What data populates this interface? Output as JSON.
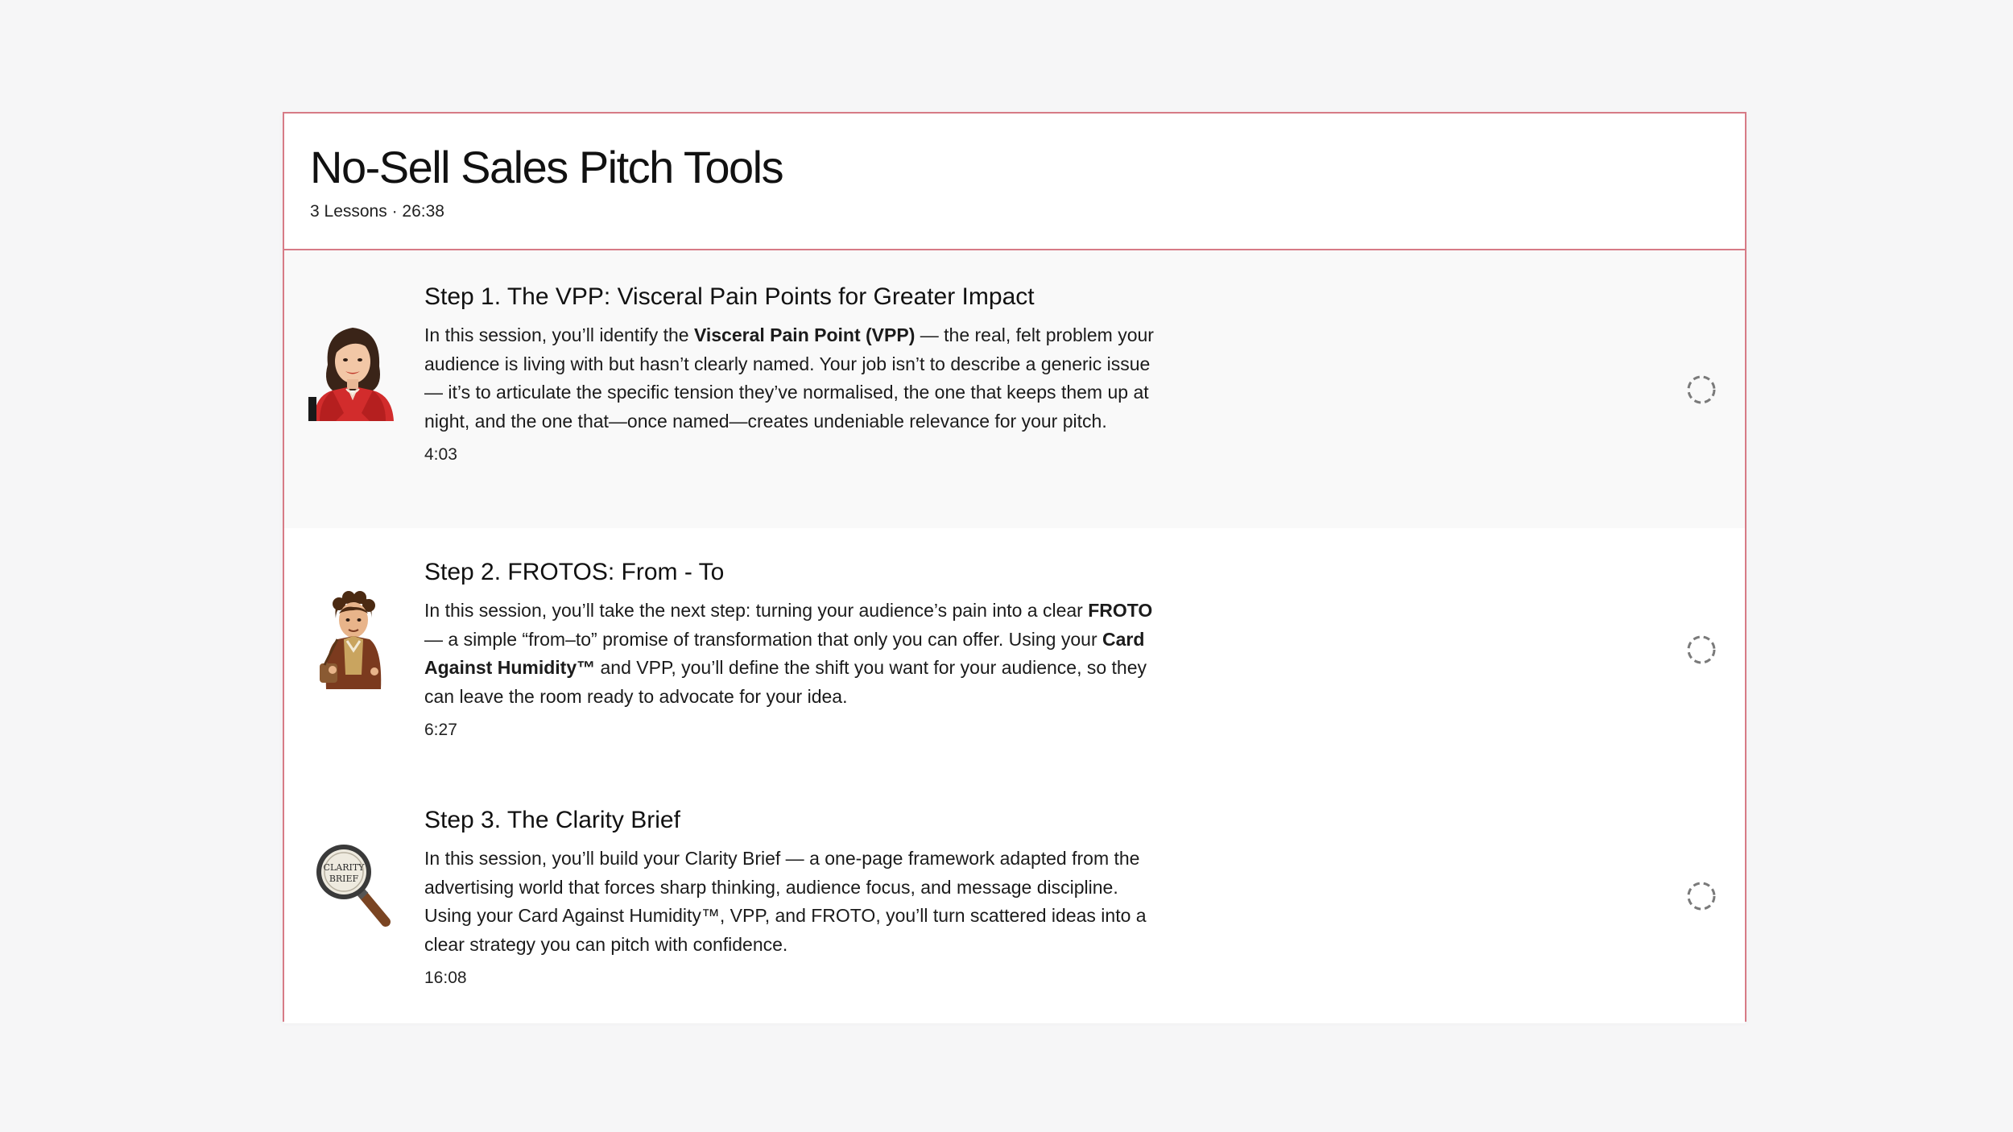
{
  "course": {
    "title": "No-Sell Sales Pitch Tools",
    "meta": "3 Lessons · 26:38"
  },
  "lessons": [
    {
      "title": "Step 1. The VPP: Visceral Pain Points for Greater Impact",
      "desc_1": "In this session, you’ll identify the ",
      "bold_1": "Visceral Pain Point (VPP)",
      "desc_2": " — the real, felt problem your audience is living with but hasn’t clearly named. Your job isn’t to describe a generic issue — it’s to articulate the specific tension they’ve normalised, the one that keeps them up at night, and the one that—once named—creates undeniable relevance for your pitch.",
      "duration": "4:03",
      "thumb_icon": "woman-red-jacket-avatar-icon",
      "status_icon": "dashed-circle-status-icon"
    },
    {
      "title": "Step 2. FROTOS: From - To",
      "desc_1": "In this session, you’ll take the next step: turning your audience’s pain into a clear ",
      "bold_1": "FROTO",
      "desc_2": " — a simple “from–to” promise of transformation that only you can offer. Using your ",
      "bold_2": "Card Against Humidity™",
      "desc_3": " and VPP, you’ll define the shift you want for your audience, so they can leave the room ready to advocate for your idea.",
      "duration": "6:27",
      "thumb_icon": "hobbit-character-avatar-icon",
      "status_icon": "dashed-circle-status-icon"
    },
    {
      "title": "Step 3. The Clarity Brief",
      "desc_1": "In this session, you’ll build your Clarity Brief — a one-page framework adapted from the advertising world that forces sharp thinking, audience focus, and message discipline. Using your Card Against Humidity™, VPP, and FROTO, you’ll turn scattered ideas into a clear strategy you can pitch with confidence.",
      "duration": "16:08",
      "thumb_icon": "magnifying-glass-icon",
      "thumb_text_1": "CLARITY",
      "thumb_text_2": "BRIEF",
      "status_icon": "dashed-circle-status-icon"
    }
  ],
  "colors": {
    "page_bg": "#f6f6f7",
    "border_accent": "#d77b86",
    "text": "#111111",
    "status_ring": "#7a7a7a"
  }
}
